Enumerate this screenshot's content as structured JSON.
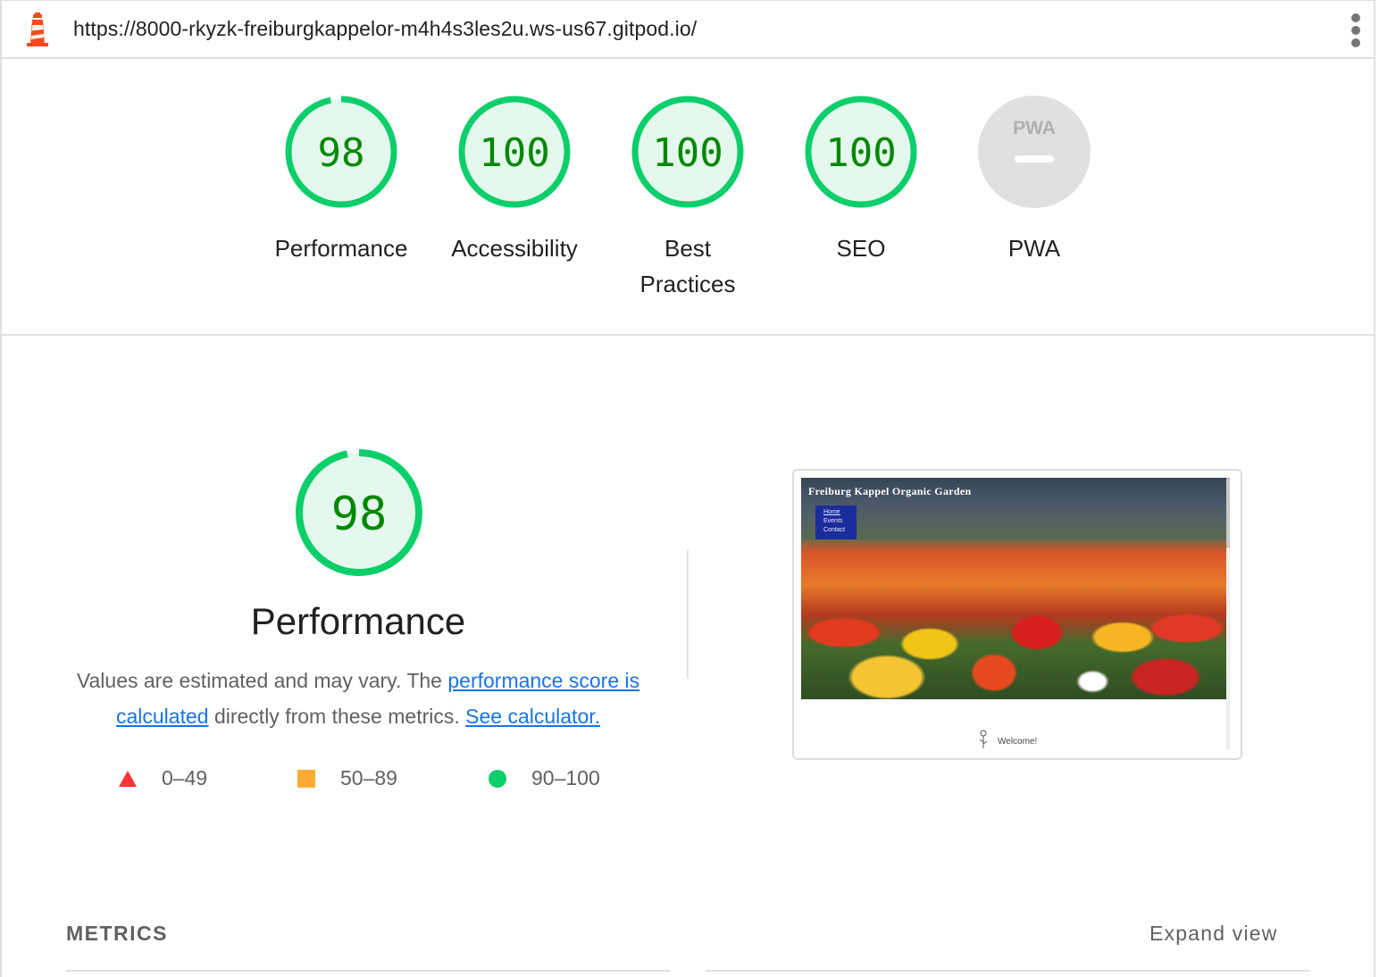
{
  "topbar": {
    "url": "https://8000-rkyzk-freiburgkappelor-m4h4s3les2u.ws-us67.gitpod.io/",
    "logo_icon": "lighthouse-icon",
    "menu_icon": "kebab-menu-icon"
  },
  "colors": {
    "pass": "#0cce6b",
    "pass_text": "#008800",
    "pass_fill": "#e5f8ed",
    "average": "#ffaa33",
    "fail": "#ff3333",
    "na": "#e0e0e0",
    "link": "#1a73e8"
  },
  "gauges": [
    {
      "value": "98",
      "score": 0.98,
      "label": "Performance"
    },
    {
      "value": "100",
      "score": 1.0,
      "label": "Accessibility"
    },
    {
      "value": "100",
      "score": 1.0,
      "label": "Best\nPractices"
    },
    {
      "value": "100",
      "score": 1.0,
      "label": "SEO"
    },
    {
      "value": "–",
      "score": null,
      "label": "PWA",
      "badge": "PWA"
    }
  ],
  "performance": {
    "score": "98",
    "score_fraction": 0.98,
    "title": "Performance",
    "desc_prefix": "Values are estimated and may vary. The ",
    "desc_link1": "performance score is calculated",
    "desc_middle": " directly from these metrics. ",
    "desc_link2": "See calculator.",
    "legend": [
      {
        "shape": "triangle",
        "range": "0–49"
      },
      {
        "shape": "square",
        "range": "50–89"
      },
      {
        "shape": "circle",
        "range": "90–100"
      }
    ]
  },
  "screenshot": {
    "site_title": "Freiburg Kappel Organic Garden",
    "nav": [
      "Home",
      "Events",
      "Contact"
    ],
    "welcome": "Welcome!"
  },
  "metrics": {
    "heading": "METRICS",
    "expand": "Expand view"
  }
}
